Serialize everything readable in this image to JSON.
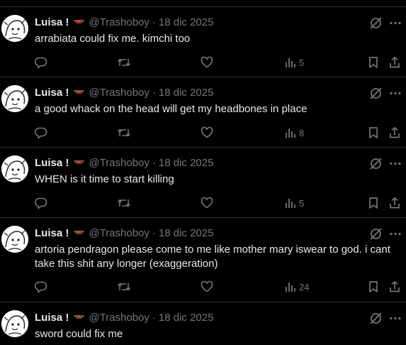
{
  "colors": {
    "background": "#000000",
    "text": "#e7e9ea",
    "muted": "#71767b",
    "divider": "#2f3336"
  },
  "icons": {
    "reply": "reply-icon",
    "retweet": "retweet-icon",
    "like": "like-icon",
    "views": "views-icon",
    "bookmark": "bookmark-icon",
    "share": "share-icon",
    "grok": "grok-icon",
    "more": "more-icon",
    "emoji": "watermelon-emoji"
  },
  "tweets": [
    {
      "author": "Luisa !",
      "handle": "@Trashoboy",
      "separator": "·",
      "date": "18 dic 2025",
      "text": "arrabiata could fix me. kimchi too",
      "views": "5"
    },
    {
      "author": "Luisa !",
      "handle": "@Trashoboy",
      "separator": "·",
      "date": "18 dic 2025",
      "text": "a good whack on the head will get my headbones in place",
      "views": "8"
    },
    {
      "author": "Luisa !",
      "handle": "@Trashoboy",
      "separator": "·",
      "date": "18 dic 2025",
      "text": "WHEN is it time to start killing",
      "views": "5"
    },
    {
      "author": "Luisa !",
      "handle": "@Trashoboy",
      "separator": "·",
      "date": "18 dic 2025",
      "text": "artoria pendragon please come to me like mother mary iswear to god. i cant take this shit any longer (exaggeration)",
      "views": "24"
    },
    {
      "author": "Luisa !",
      "handle": "@Trashoboy",
      "separator": "·",
      "date": "18 dic 2025",
      "text": "sword could fix me",
      "views": ""
    }
  ]
}
